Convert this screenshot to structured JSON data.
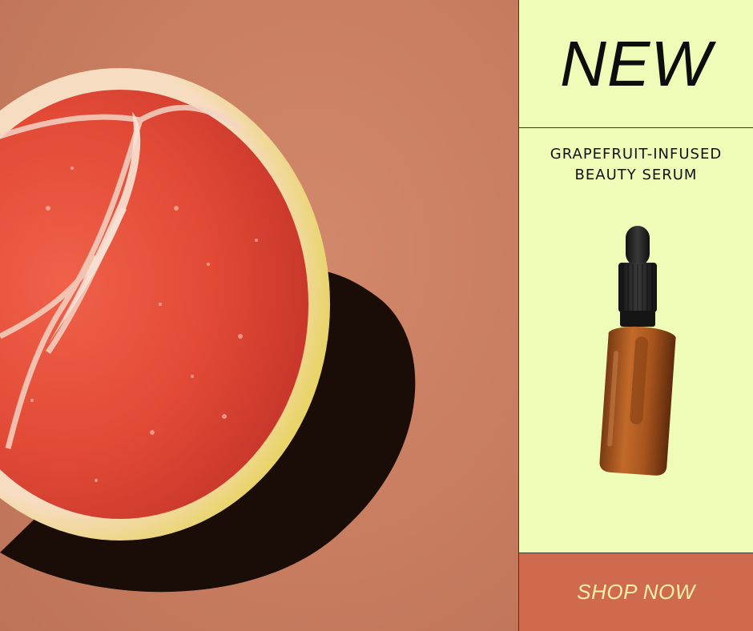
{
  "ad": {
    "headline": "NEW",
    "subtitle_line1": "GRAPEFRUIT-INFUSED",
    "subtitle_line2": "BEAUTY SERUM",
    "cta_label": "SHOP NOW"
  },
  "colors": {
    "background_photo": "#c97e62",
    "panel": "#eefcb8",
    "cta_bg": "#cf6a4e",
    "cta_text": "#f6f0a8",
    "text": "#0d0d0d"
  }
}
